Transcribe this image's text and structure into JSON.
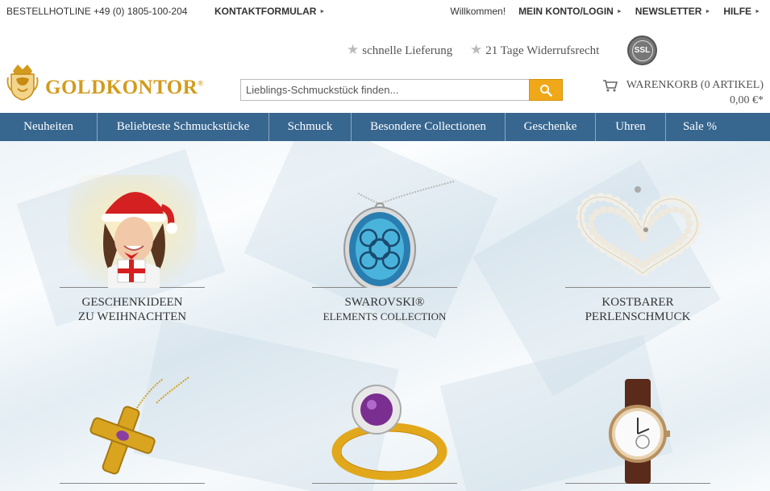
{
  "topbar": {
    "hotline": "BESTELLHOTLINE +49 (0) 1805-100-204",
    "contact": "KONTAKTFORMULAR",
    "welcome": "Willkommen!",
    "account": "MEIN KONTO/LOGIN",
    "newsletter": "NEWSLETTER",
    "help": "HILFE"
  },
  "trust": {
    "delivery": "schnelle Lieferung",
    "returns": "21 Tage Widerrufsrecht",
    "ssl": "SSL"
  },
  "logo": {
    "text": "GOLDKONTOR",
    "mark": "®"
  },
  "search": {
    "placeholder": "Lieblings-Schmuckstück finden..."
  },
  "cart": {
    "label": "WARENKORB (0 ARTIKEL)",
    "total": "0,00 €*"
  },
  "nav": [
    "Neuheiten",
    "Beliebteste Schmuckstücke",
    "Schmuck",
    "Besondere Collectionen",
    "Geschenke",
    "Uhren",
    "Sale %"
  ],
  "tiles": [
    {
      "line1": "GESCHENKIDEEN",
      "line2": "ZU WEIHNACHTEN"
    },
    {
      "line1": "SWAROVSKI®",
      "line2": "ELEMENTS COLLECTION"
    },
    {
      "line1": "KOSTBARER",
      "line2": "PERLENSCHMUCK"
    }
  ],
  "colors": {
    "nav": "#37668f",
    "gold": "#d39b1c",
    "search_button": "#f0a818"
  }
}
